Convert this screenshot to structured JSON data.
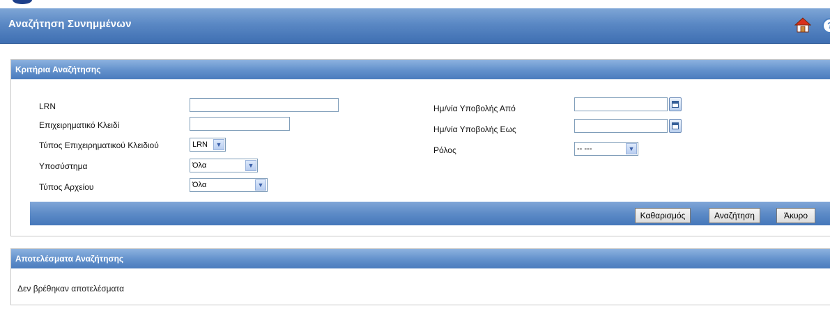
{
  "header": {
    "title": "Αναζήτηση Συνημμένων"
  },
  "criteria": {
    "title": "Κριτήρια Αναζήτησης",
    "lrn": {
      "label": "LRN",
      "value": ""
    },
    "business_key": {
      "label": "Επιχειρηματικό Κλειδί",
      "value": ""
    },
    "business_key_type": {
      "label": "Τύπος Επιχειρηματικού Κλειδιού",
      "value": "LRN"
    },
    "subsystem": {
      "label": "Υποσύστημα",
      "value": "Όλα"
    },
    "file_type": {
      "label": "Τύπος Αρχείου",
      "value": "Όλα"
    },
    "date_from": {
      "label": "Ημ/νία Υποβολής Από",
      "value": ""
    },
    "date_to": {
      "label": "Ημ/νία Υποβολής Εως",
      "value": ""
    },
    "role": {
      "label": "Ρόλος",
      "value": "-- ---"
    },
    "buttons": {
      "clear": "Καθαρισμός",
      "search": "Αναζήτηση",
      "cancel": "Άκυρο"
    }
  },
  "results": {
    "title": "Αποτελέσματα Αναζήτησης",
    "empty_message": "Δεν βρέθηκαν αποτελέσματα"
  },
  "colors": {
    "header_blue": "#4a7bbd",
    "home_roof": "#d9301c"
  },
  "icons": [
    "home-icon",
    "help-icon",
    "calendar-icon",
    "chevron-down-icon"
  ]
}
